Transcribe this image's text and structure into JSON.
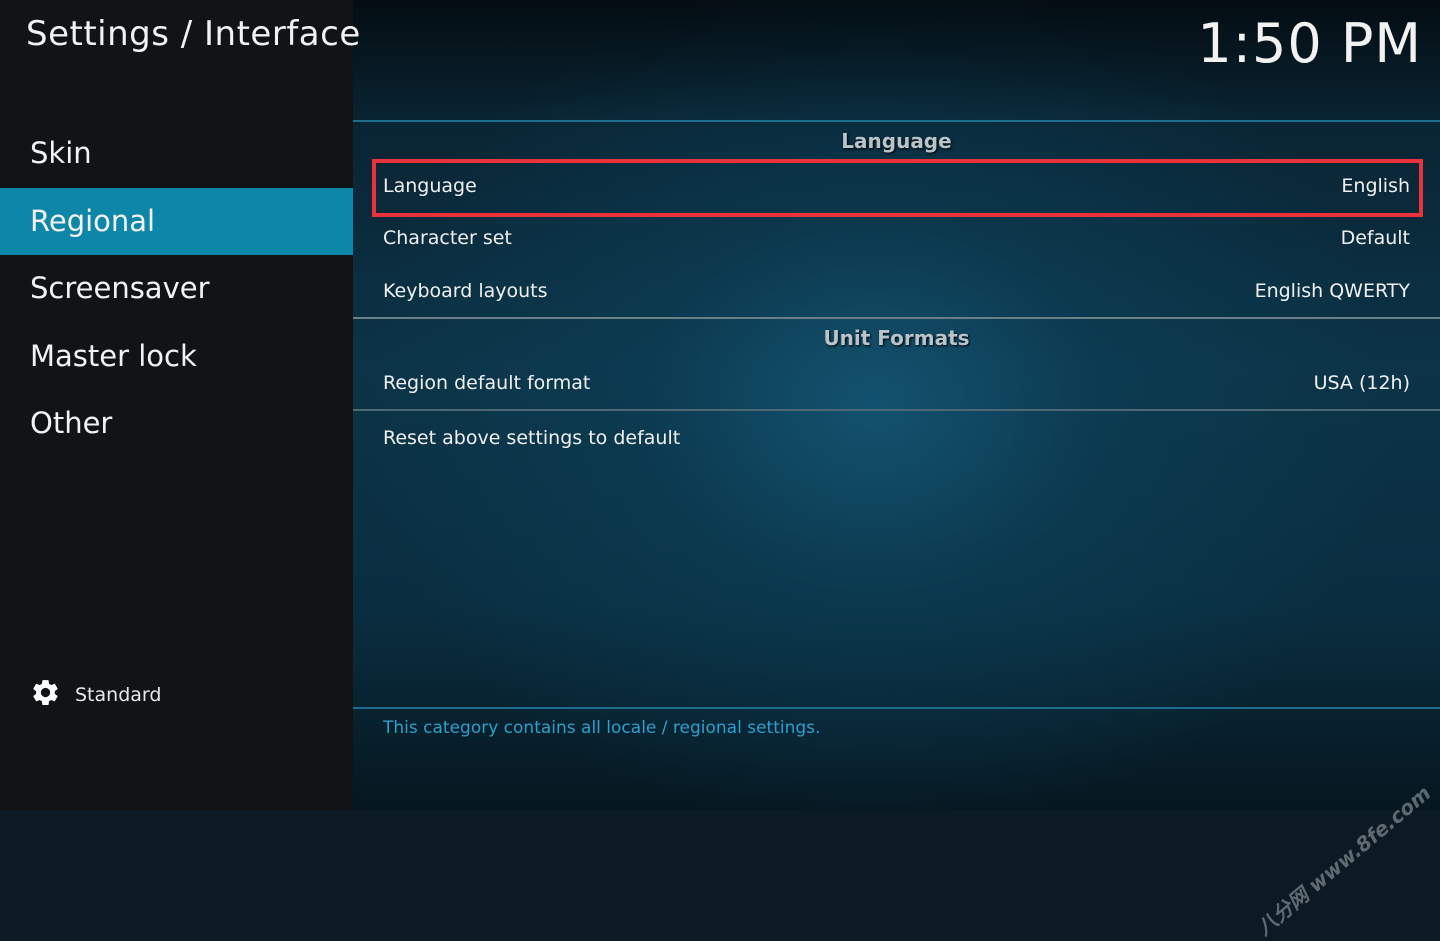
{
  "header": {
    "title": "Settings / Interface",
    "clock": "1:50 PM"
  },
  "sidebar": {
    "items": [
      {
        "label": "Skin"
      },
      {
        "label": "Regional"
      },
      {
        "label": "Screensaver"
      },
      {
        "label": "Master lock"
      },
      {
        "label": "Other"
      }
    ],
    "active_index": 1,
    "settings_level": {
      "icon": "gear-icon",
      "label": "Standard"
    }
  },
  "content": {
    "sections": [
      {
        "title": "Language",
        "rows": [
          {
            "label": "Language",
            "value": "English"
          },
          {
            "label": "Character set",
            "value": "Default"
          },
          {
            "label": "Keyboard layouts",
            "value": "English QWERTY"
          }
        ]
      },
      {
        "title": "Unit Formats",
        "rows": [
          {
            "label": "Region default format",
            "value": "USA (12h)"
          }
        ]
      }
    ],
    "reset_label": "Reset above settings to default",
    "description": "This category contains all locale / regional settings."
  },
  "watermark": {
    "line1": "八分网",
    "line2": "www.8fe.com"
  },
  "colors": {
    "accent": "#0e86a8",
    "highlight_border": "#e8333b",
    "description_text": "#2f9fcc",
    "sidebar_bg": "#111417"
  }
}
